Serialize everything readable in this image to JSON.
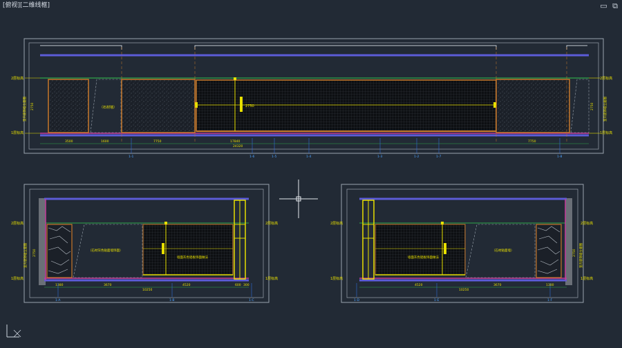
{
  "window": {
    "title": "[俯视][二维线框]",
    "minimize_icon": "minimize-icon",
    "restore_icon": "restore-icon"
  },
  "status": {
    "ucs_icon": "ucs-axis-icon"
  },
  "colors": {
    "background": "#222a35",
    "blue_line": "#5c5cd8",
    "green_line": "#2fa84a",
    "orange_line": "#c8782a",
    "yellow_line": "#e8e000",
    "magenta_line": "#c43a9a",
    "frame_line": "#9aa4ae"
  },
  "elevation_top": {
    "level_labels": [
      "2层标高",
      "1层标高"
    ],
    "side_labels": [
      "室内装饰墙立面图",
      "室内装饰墙立面图"
    ],
    "dims_left": [
      "2750"
    ],
    "dims_right": [
      "2750"
    ],
    "bottom_dims": [
      "3500",
      "1600",
      "7750",
      "17840",
      "7750"
    ],
    "total_dim": "24320",
    "center_note": "（石材墙）",
    "center_dim": "2750",
    "axis_tags": [
      "1-1",
      "1-6",
      "1-5",
      "1-4",
      "1-3",
      "1-2",
      "1-7",
      "1-8"
    ]
  },
  "elevation_left": {
    "level_labels": [
      "2层标高",
      "1层标高"
    ],
    "side_labels": [
      "室内装饰墙立面图"
    ],
    "dims_left": [
      "2750"
    ],
    "bottom_dims": [
      "1380",
      "3670",
      "4520",
      "600",
      "300"
    ],
    "total_dim": "10250",
    "note_a": "（石材灰色贴面墙饰面）",
    "note_b": "墙面灰色铝板饰面做法",
    "axis_tags": [
      "1-A",
      "1-B",
      "1-C"
    ]
  },
  "elevation_right": {
    "level_labels": [
      "2层标高",
      "1层标高"
    ],
    "side_labels": [
      "室内装饰墙立面图"
    ],
    "dims_right": [
      "2750"
    ],
    "bottom_dims": [
      "4520",
      "3670",
      "1380"
    ],
    "total_dim": "10250",
    "note_a": "（石材贴面墙）",
    "note_b": "墙面灰色铝板饰面做法",
    "axis_tags": [
      "1-D",
      "1-E",
      "1-F"
    ]
  }
}
